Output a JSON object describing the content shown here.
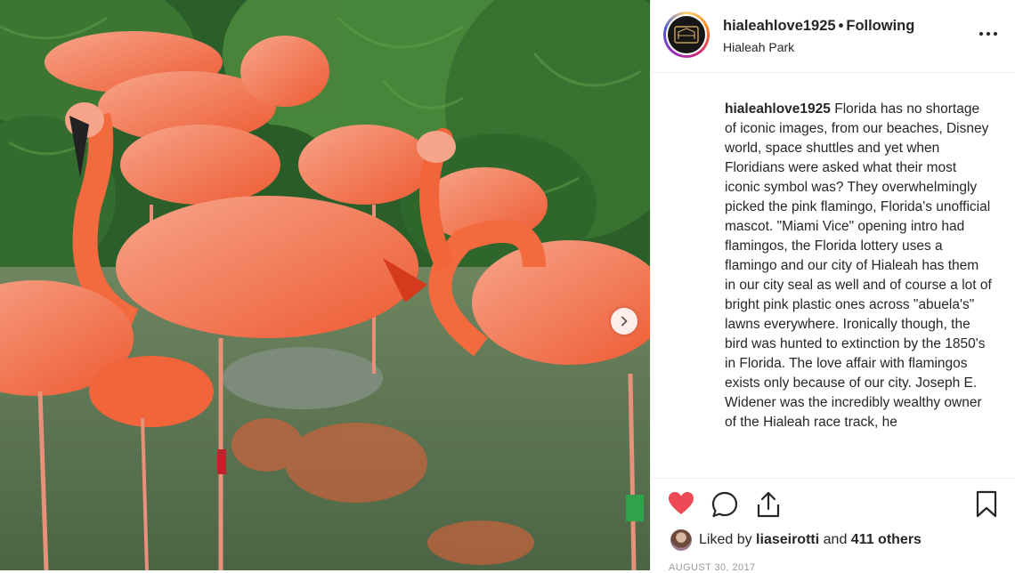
{
  "post": {
    "username": "hialeahlove1925",
    "follow_separator": "•",
    "follow_status": "Following",
    "location": "Hialeah Park",
    "avatar_icon": "hialeah-park-logo-icon"
  },
  "caption": {
    "username": "hialeahlove1925",
    "text": "Florida has no shortage of iconic images, from our beaches, Disney world, space shuttles and yet when Floridians were asked what their most iconic symbol was? They overwhelmingly picked the pink flamingo, Florida's unofficial mascot. \"Miami Vice\" opening intro had flamingos, the Florida lottery uses a flamingo and our city of Hialeah has them in our city seal as well and of course a lot of bright pink plastic ones across \"abuela's\" lawns everywhere. Ironically though, the bird was hunted to extinction by the 1850's in Florida. The love affair with flamingos exists only because of our city. Joseph E. Widener was the incredibly wealthy owner of the Hialeah race track, he"
  },
  "actions": {
    "like_icon": "heart-filled-icon",
    "comment_icon": "comment-bubble-icon",
    "share_icon": "share-upload-icon",
    "save_icon": "bookmark-icon",
    "like_color": "#ed4956"
  },
  "likes": {
    "prefix": "Liked by",
    "user": "liaseirotti",
    "middle": "and",
    "others": "411 others"
  },
  "date": "AUGUST 30, 2017",
  "photo": {
    "description_icon": "flamingos-photo",
    "next_icon": "chevron-right-icon"
  },
  "colors": {
    "flamingo": "#f2643a",
    "foliage": "#2f6a2d",
    "water": "#5d7a55"
  }
}
